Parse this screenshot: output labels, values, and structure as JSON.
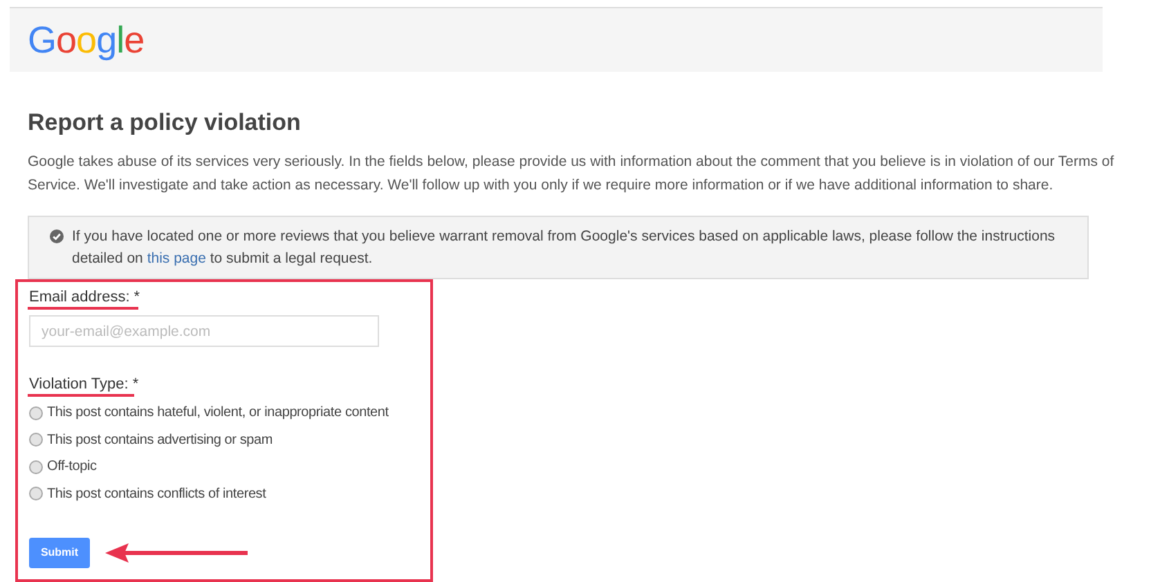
{
  "header": {
    "logo": "Google"
  },
  "title": "Report a policy violation",
  "intro": "Google takes abuse of its services very seriously. In the fields below, please provide us with information about the comment that you believe is in violation of our Terms of Service. We'll investigate and take action as necessary. We'll follow up with you only if we require more information or if we have additional information to share.",
  "notice": {
    "text_before": "If you have located one or more reviews that you believe warrant removal from Google's services based on applicable laws, please follow the instructions detailed on",
    "link": "this page",
    "text_after": "to submit a legal request."
  },
  "form": {
    "email_label": "Email address: *",
    "email_placeholder": "your-email@example.com",
    "violation_label": "Violation Type: *",
    "options": [
      {
        "label": "This post contains hateful, violent, or inappropriate content",
        "selected": false
      },
      {
        "label": "This post contains advertising or spam",
        "selected": false
      },
      {
        "label": "Off-topic",
        "selected": false
      },
      {
        "label": "This post contains conflicts of interest",
        "selected": false
      }
    ],
    "submit": "Submit"
  }
}
